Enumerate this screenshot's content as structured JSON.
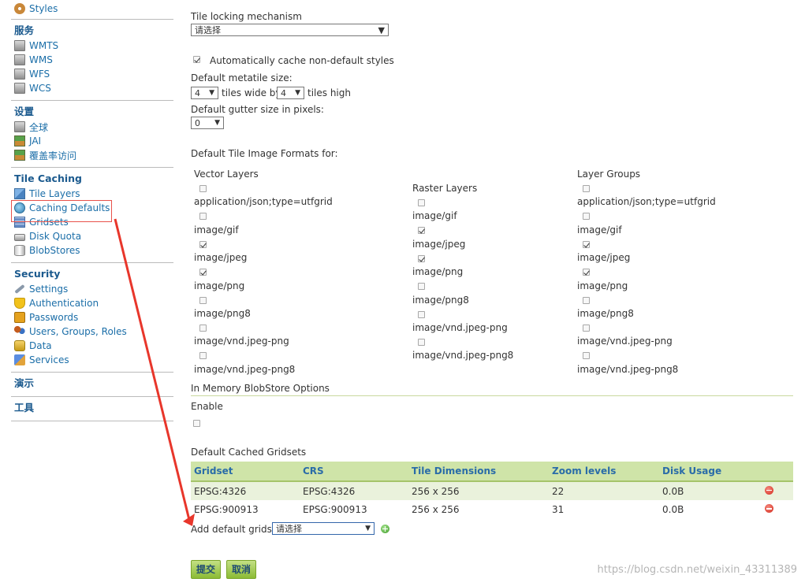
{
  "sidebar": {
    "styles_label": "Styles",
    "services_title": "服务",
    "services": [
      "WMTS",
      "WMS",
      "WFS",
      "WCS"
    ],
    "settings_title": "设置",
    "settings": [
      "全球",
      "JAI",
      "覆盖率访问"
    ],
    "tile_title": "Tile Caching",
    "tile_items": [
      "Tile Layers",
      "Caching Defaults",
      "Gridsets",
      "Disk Quota",
      "BlobStores"
    ],
    "security_title": "Security",
    "security_items": [
      "Settings",
      "Authentication",
      "Passwords",
      "Users, Groups, Roles",
      "Data",
      "Services"
    ],
    "demo_title": "演示",
    "tools_title": "工具"
  },
  "form": {
    "tile_locking_label": "Tile locking mechanism",
    "tile_locking_value": "请选择",
    "auto_cache_label": "Automatically cache non-default styles",
    "metatile_label": "Default metatile size:",
    "metatile_wide": "4",
    "tiles_wide_by": "tiles wide by",
    "metatile_high": "4",
    "tiles_high": "tiles high",
    "gutter_label": "Default gutter size in pixels:",
    "gutter_value": "0",
    "formats_label": "Default Tile Image Formats for:",
    "inmem_label": "In Memory BlobStore Options",
    "enable_label": "Enable",
    "cached_gridsets_label": "Default Cached Gridsets",
    "add_gridset_label": "Add default gridset",
    "add_gridset_value": "请选择",
    "submit_label": "提交",
    "cancel_label": "取消"
  },
  "formats": {
    "vector": {
      "title": "Vector Layers",
      "items": [
        {
          "label": "application/json;type=utfgrid",
          "checked": false
        },
        {
          "label": "image/gif",
          "checked": false
        },
        {
          "label": "image/jpeg",
          "checked": true
        },
        {
          "label": "image/png",
          "checked": true
        },
        {
          "label": "image/png8",
          "checked": false
        },
        {
          "label": "image/vnd.jpeg-png",
          "checked": false
        },
        {
          "label": "image/vnd.jpeg-png8",
          "checked": false
        }
      ]
    },
    "raster": {
      "title": "Raster Layers",
      "items": [
        {
          "label": "image/gif",
          "checked": false
        },
        {
          "label": "image/jpeg",
          "checked": true
        },
        {
          "label": "image/png",
          "checked": true
        },
        {
          "label": "image/png8",
          "checked": false
        },
        {
          "label": "image/vnd.jpeg-png",
          "checked": false
        },
        {
          "label": "image/vnd.jpeg-png8",
          "checked": false
        }
      ]
    },
    "groups": {
      "title": "Layer Groups",
      "items": [
        {
          "label": "application/json;type=utfgrid",
          "checked": false
        },
        {
          "label": "image/gif",
          "checked": false
        },
        {
          "label": "image/jpeg",
          "checked": true
        },
        {
          "label": "image/png",
          "checked": true
        },
        {
          "label": "image/png8",
          "checked": false
        },
        {
          "label": "image/vnd.jpeg-png",
          "checked": false
        },
        {
          "label": "image/vnd.jpeg-png8",
          "checked": false
        }
      ]
    }
  },
  "gridsets": {
    "headers": [
      "Gridset",
      "CRS",
      "Tile Dimensions",
      "Zoom levels",
      "Disk Usage"
    ],
    "rows": [
      [
        "EPSG:4326",
        "EPSG:4326",
        "256 x 256",
        "22",
        "0.0B"
      ],
      [
        "EPSG:900913",
        "EPSG:900913",
        "256 x 256",
        "31",
        "0.0B"
      ]
    ]
  },
  "watermark": "https://blog.csdn.net/weixin_43311389"
}
